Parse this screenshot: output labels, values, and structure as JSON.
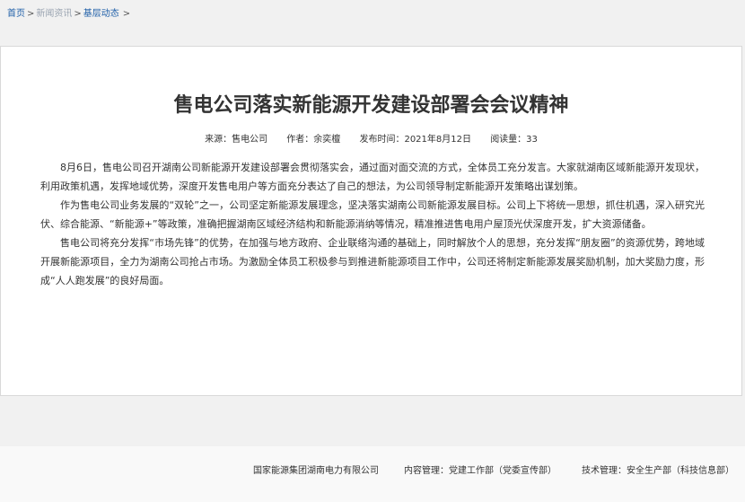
{
  "breadcrumb": {
    "home": "首页",
    "news": "新闻资讯",
    "current": "基层动态",
    "separator": ">"
  },
  "article": {
    "title": "售电公司落实新能源开发建设部署会会议精神",
    "meta": {
      "source": "来源：售电公司",
      "author": "作者：余奕檀",
      "published": "发布时间：2021年8月12日",
      "views": "阅读量：33"
    },
    "paragraphs": [
      "8月6日，售电公司召开湖南公司新能源开发建设部署会贯彻落实会，通过面对面交流的方式，全体员工充分发言。大家就湖南区域新能源开发现状，利用政策机遇，发挥地域优势，深度开发售电用户等方面充分表达了自己的想法，为公司领导制定新能源开发策略出谋划策。",
      "作为售电公司业务发展的“双轮”之一，公司坚定新能源发展理念，坚决落实湖南公司新能源发展目标。公司上下将统一思想，抓住机遇，深入研究光伏、综合能源、“新能源+”等政策，准确把握湖南区域经济结构和新能源消纳等情况，精准推进售电用户屋顶光伏深度开发，扩大资源储备。",
      "售电公司将充分发挥“市场先锋”的优势，在加强与地方政府、企业联络沟通的基础上，同时解放个人的思想，充分发挥“朋友圈”的资源优势，跨地域开展新能源项目，全力为湖南公司抢占市场。为激励全体员工积极参与到推进新能源项目工作中，公司还将制定新能源发展奖励机制，加大奖励力度，形成“人人跑发展”的良好局面。"
    ]
  },
  "footer": {
    "company": "国家能源集团湖南电力有限公司",
    "content_management": "内容管理：党建工作部（党委宣传部）",
    "tech_management": "技术管理：安全生产部（科技信息部）"
  },
  "colors": {
    "link": "#1f5fa8",
    "muted_link": "#9aa4b1",
    "page_background": "#f1f1f1",
    "card_background": "#ffffff"
  }
}
